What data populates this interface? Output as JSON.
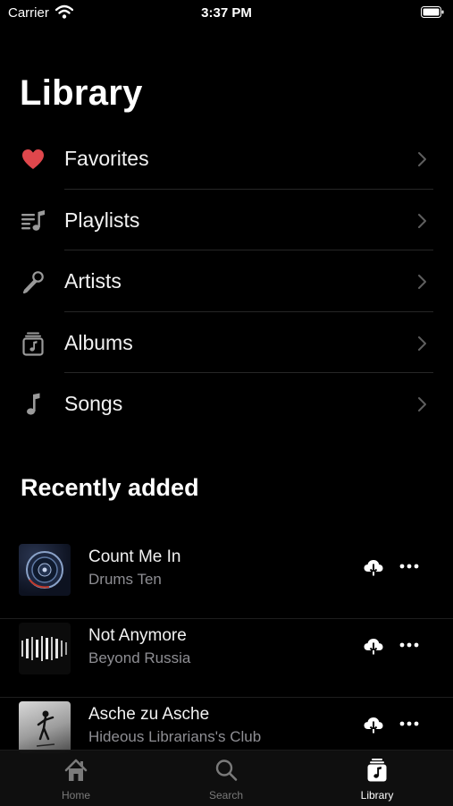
{
  "status_bar": {
    "carrier": "Carrier",
    "time": "3:37 PM"
  },
  "page_title": "Library",
  "menu": [
    {
      "label": "Favorites",
      "icon": "heart-icon"
    },
    {
      "label": "Playlists",
      "icon": "playlist-icon"
    },
    {
      "label": "Artists",
      "icon": "microphone-icon"
    },
    {
      "label": "Albums",
      "icon": "album-icon"
    },
    {
      "label": "Songs",
      "icon": "music-note-icon"
    }
  ],
  "recently_added": {
    "title": "Recently added",
    "tracks": [
      {
        "title": "Count Me In",
        "artist": "Drums Ten"
      },
      {
        "title": "Not Anymore",
        "artist": "Beyond Russia"
      },
      {
        "title": "Asche zu Asche",
        "artist": "Hideous Librarians's Club"
      }
    ]
  },
  "tab_bar": {
    "tabs": [
      {
        "label": "Home",
        "icon": "home-icon",
        "active": false
      },
      {
        "label": "Search",
        "icon": "search-icon",
        "active": false
      },
      {
        "label": "Library",
        "icon": "library-icon",
        "active": true
      }
    ]
  },
  "colors": {
    "background": "#000000",
    "heart": "#e0474c",
    "secondary_text": "#8e8e93",
    "inactive_tab": "#7a7a7a"
  }
}
